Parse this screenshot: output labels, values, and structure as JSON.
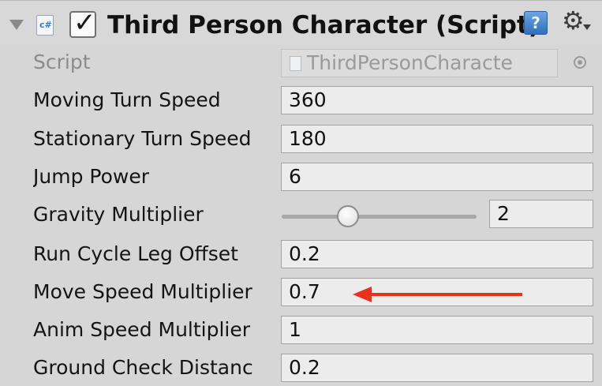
{
  "component": {
    "title": "Third Person Character (Script)",
    "enabled": true
  },
  "script_row": {
    "label": "Script",
    "value": "ThirdPersonCharacte"
  },
  "properties": [
    {
      "label": "Moving Turn Speed",
      "value": "360"
    },
    {
      "label": "Stationary Turn Speed",
      "value": "180"
    },
    {
      "label": "Jump Power",
      "value": "6"
    },
    {
      "label": "Gravity Multiplier",
      "value": "2",
      "slider_fraction": 0.34
    },
    {
      "label": "Run Cycle Leg Offset",
      "value": "0.2"
    },
    {
      "label": "Move Speed Multiplier",
      "value": "0.7"
    },
    {
      "label": "Anim Speed Multiplier",
      "value": "1"
    },
    {
      "label": "Ground Check Distanc",
      "value": "0.2"
    }
  ],
  "icons": {
    "foldout": "foldout-triangle-icon",
    "script": "csharp-script-icon",
    "help": "help-book-icon",
    "settings": "gear-icon",
    "picker": "object-picker-icon"
  },
  "colors": {
    "panel_bg": "#d6d6d6",
    "field_bg": "#ececec",
    "annotation_arrow": "#e8321e"
  }
}
